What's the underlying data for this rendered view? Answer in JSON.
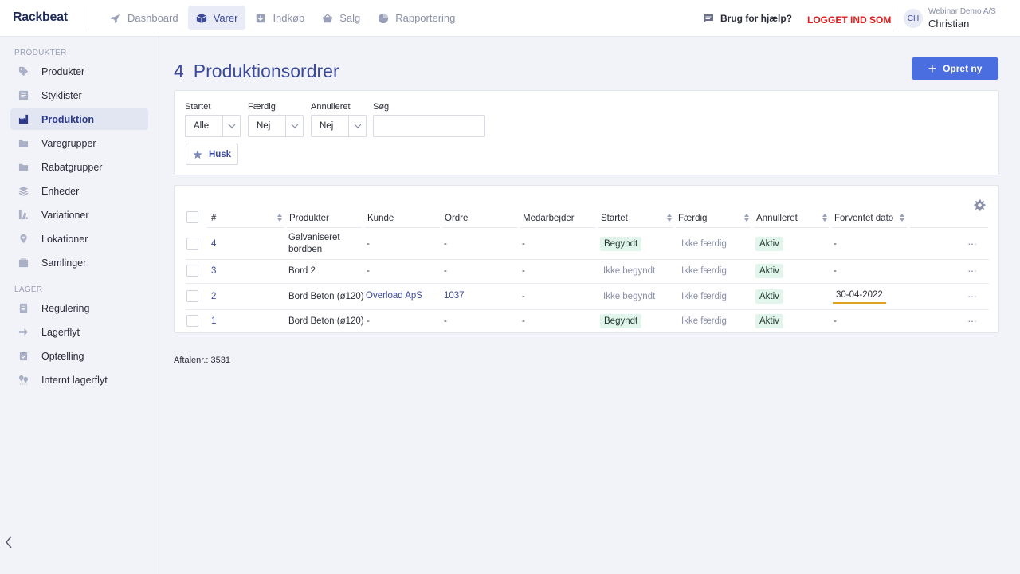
{
  "app": {
    "logo": "Rackbeat"
  },
  "nav": [
    {
      "label": "Dashboard",
      "icon": "rocket-icon"
    },
    {
      "label": "Varer",
      "icon": "box-icon",
      "active": true
    },
    {
      "label": "Indkøb",
      "icon": "download-icon"
    },
    {
      "label": "Salg",
      "icon": "basket-icon"
    },
    {
      "label": "Rapportering",
      "icon": "pie-chart-icon"
    }
  ],
  "header": {
    "help_label": "Brug for hjælp?",
    "logged_in_label": "LOGGET IND SOM",
    "avatar_initials": "CH",
    "company": "Webinar Demo A/S",
    "username": "Christian"
  },
  "sidebar": {
    "section_products": "PRODUKTER",
    "section_stock": "LAGER",
    "items": [
      {
        "label": "Produkter",
        "icon": "tag-icon"
      },
      {
        "label": "Styklister",
        "icon": "list-icon"
      },
      {
        "label": "Produktion",
        "icon": "factory-icon",
        "active": true
      },
      {
        "label": "Varegrupper",
        "icon": "folder-icon"
      },
      {
        "label": "Rabatgrupper",
        "icon": "folder-icon"
      },
      {
        "label": "Enheder",
        "icon": "layers-icon"
      },
      {
        "label": "Variationer",
        "icon": "variations-icon"
      },
      {
        "label": "Lokationer",
        "icon": "location-pin-icon"
      },
      {
        "label": "Samlinger",
        "icon": "collection-icon"
      },
      {
        "label": "Regulering",
        "icon": "document-icon"
      },
      {
        "label": "Lagerflyt",
        "icon": "arrow-right-icon"
      },
      {
        "label": "Optælling",
        "icon": "clipboard-check-icon"
      },
      {
        "label": "Internt lagerflyt",
        "icon": "pins-icon"
      }
    ]
  },
  "page": {
    "count": "4",
    "title": "Produktionsordrer",
    "new_button": "Opret ny",
    "agreement": "Aftalenr.: 3531"
  },
  "filters": {
    "started_label": "Startet",
    "started_value": "Alle",
    "finished_label": "Færdig",
    "finished_value": "Nej",
    "cancelled_label": "Annulleret",
    "cancelled_value": "Nej",
    "search_label": "Søg",
    "search_value": "",
    "save_button": "Husk"
  },
  "table": {
    "columns": [
      "#",
      "Produkter",
      "Kunde",
      "Ordre",
      "Medarbejder",
      "Startet",
      "Færdig",
      "Annulleret",
      "Forventet dato"
    ],
    "rows": [
      {
        "id": "4",
        "product_line1": "Galvaniseret",
        "product_line2": "bordben",
        "customer": "-",
        "order": "-",
        "employee": "-",
        "started": "Begyndt",
        "finished": "Ikke færdig",
        "cancelled": "Aktiv",
        "expected": "-"
      },
      {
        "id": "3",
        "product_line1": "Bord 2",
        "product_line2": "",
        "customer": "-",
        "order": "-",
        "employee": "-",
        "started": "Ikke begyndt",
        "finished": "Ikke færdig",
        "cancelled": "Aktiv",
        "expected": "-"
      },
      {
        "id": "2",
        "product_line1": "Bord Beton (ø120)",
        "product_line2": "",
        "customer": "Overload ApS",
        "order": "1037",
        "employee": "-",
        "started": "Ikke begyndt",
        "finished": "Ikke færdig",
        "cancelled": "Aktiv",
        "expected": "30-04-2022"
      },
      {
        "id": "1",
        "product_line1": "Bord Beton (ø120)",
        "product_line2": "",
        "customer": "-",
        "order": "-",
        "employee": "-",
        "started": "Begyndt",
        "finished": "Ikke færdig",
        "cancelled": "Aktiv",
        "expected": "-"
      }
    ]
  },
  "colors": {
    "accent": "#4a6ee0",
    "title": "#3c4a9c",
    "logged_in": "#e01d1d",
    "badge_green": "#e2f5ec",
    "date_underline": "#e0a020"
  }
}
